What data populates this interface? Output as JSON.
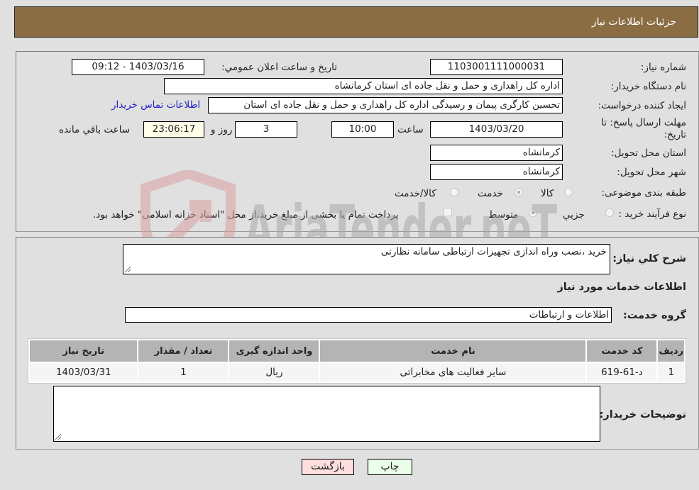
{
  "header": {
    "title": "جزئیات اطلاعات نیاز"
  },
  "details": {
    "need_number_label": "شماره نیاز:",
    "need_number": "1103001111000031",
    "announce_label": "تاریخ و ساعت اعلان عمومي:",
    "announce_value": "1403/03/16 - 09:12",
    "buyer_org_label": "نام دستگاه خريدار:",
    "buyer_org": "اداره کل راهداری و حمل و نقل جاده ای استان کرمانشاه",
    "requester_label": "ایجاد کننده درخواست:",
    "requester": "تحسین کارگری پیمان و رسیدگی اداره کل راهداری و حمل و نقل جاده ای استان",
    "buyer_contact_link": "اطلاعات تماس خریدار",
    "deadline_label": "مهلت ارسال پاسخ: تا تاریخ:",
    "deadline_date": "1403/03/20",
    "time_label": "ساعت",
    "deadline_time": "10:00",
    "days_value": "3",
    "days_label": "روز و",
    "remaining_time": "23:06:17",
    "remaining_label": "ساعت باقي مانده",
    "province_label": "استان محل تحویل:",
    "province": "کرمانشاه",
    "city_label": "شهر محل تحویل:",
    "city": "کرمانشاه",
    "category_label": "طبقه بندی موضوعی:",
    "category_options": [
      {
        "label": "کالا",
        "selected": false
      },
      {
        "label": "خدمت",
        "selected": true
      },
      {
        "label": "کالا/خدمت",
        "selected": false
      }
    ],
    "process_label": "نوع فرآیند خرید :",
    "process_options": [
      {
        "label": "جزيي",
        "selected": false
      },
      {
        "label": "متوسط",
        "selected": true
      }
    ],
    "treasury_note": "پرداخت تمام یا بخشی از مبلغ خرید،از محل \"اسناد خزانه اسلامی\" خواهد بود.",
    "treasury_checked": false
  },
  "summary": {
    "description_label": "شرح کلي نياز:",
    "description": "خرید ،نصب وراه اندازی تجهیزات ارتباطی سامانه نظارتی",
    "services_heading": "اطلاعات خدمات مورد نياز",
    "service_group_label": "گروه خدمت:",
    "service_group": "اطلاعات و ارتباطات"
  },
  "table": {
    "columns": [
      "ردیف",
      "کد خدمت",
      "نام خدمت",
      "واحد اندازه گیری",
      "تعداد / مقدار",
      "تاریخ نیاز"
    ],
    "rows": [
      [
        "1",
        "د-61-619",
        "سایر فعالیت های مخابراتی",
        "ریال",
        "1",
        "1403/03/31"
      ]
    ]
  },
  "buyer_notes": {
    "label": "توضیحات خریدار:",
    "value": ""
  },
  "buttons": {
    "print": "چاپ",
    "back": "بازگشت"
  },
  "watermark": {
    "text": "AriaTender.neT"
  },
  "colors": {
    "header_bg": "#8b6d43",
    "link": "#2424c8",
    "print_bg": "#eaffea",
    "back_bg": "#ffdede",
    "table_header_bg": "#b4b4b4"
  }
}
